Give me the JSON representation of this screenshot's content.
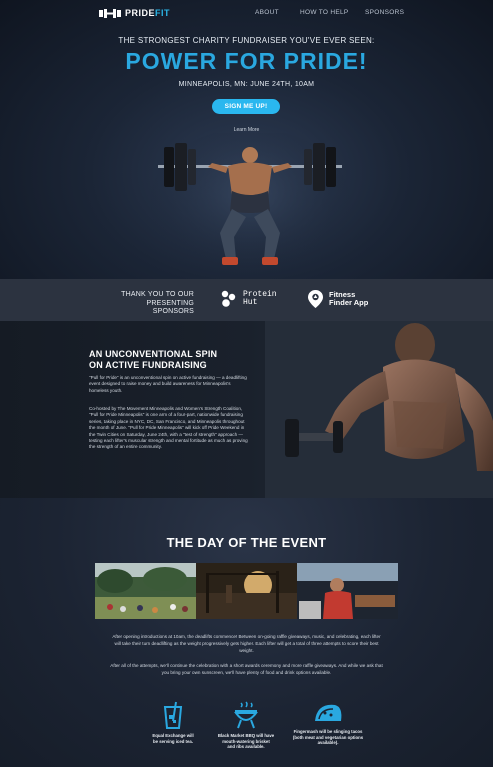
{
  "nav": {
    "brand_main": "PRIDE",
    "brand_accent": "FIT",
    "links": [
      "ABOUT",
      "HOW TO HELP",
      "SPONSORS"
    ]
  },
  "hero": {
    "tagline": "THE STRONGEST CHARITY FUNDRAISER YOU'VE EVER SEEN:",
    "headline": "POWER FOR PRIDE!",
    "when": "MINNEAPOLIS, MN: JUNE 24TH, 10AM",
    "cta": "SIGN ME UP!",
    "learn_more": "Learn More"
  },
  "sponsors": {
    "thanks_line1": "THANK YOU TO OUR",
    "thanks_line2": "PRESENTING SPONSORS",
    "sponsor1_line1": "Protein",
    "sponsor1_line2": "Hut",
    "sponsor2_line1": "Fitness",
    "sponsor2_line2": "Finder App"
  },
  "spin": {
    "title_line1": "AN UNCONVENTIONAL SPIN",
    "title_line2": "ON ACTIVE FUNDRAISING",
    "p1": "\"Pull for Pride\" is an unconventional spin on active fundraising — a deadlifting event designed to raise money and build awareness for Minneapolis's homeless youth.",
    "p2": "Co-hosted by The Movement Minneapolis and Women's Strength Coalition, \"Pull for Pride Minneapolis\" is one arm of a four-part, nationwide fundraising series, taking place in NYC, DC, San Francisco, and Minneapolis throughout the month of June. \"Pull for Pride Minneapolis\" will kick off Pride Weekend in the Twin Cities on Saturday, June 24th, with a \"test of strength\" approach — testing each lifter's muscular strength and mental fortitude as much as proving the strength of an entire community."
  },
  "day": {
    "title": "THE DAY OF THE EVENT",
    "p1": "After opening introductions at 10am, the deadlifts commence! Between on-going raffle giveaways, music, and celebrating, each lifter will take their turn deadlifting as the weight progressively gets higher. Each lifter will get a total of three attempts to score their best weight.",
    "p2": "After all of the attempts, we'll continue the celebration with a short awards ceremony and more raffle giveaways. And while we ask that you bring your own sunscreen, we'll have plenty of food and drink options available.",
    "features": [
      {
        "icon": "iced-tea-icon",
        "text_line1": "Equal Exchange will",
        "text_line2": "be serving iced tea.",
        "text_line3": ""
      },
      {
        "icon": "grill-icon",
        "text_line1": "Black Market BBQ will have",
        "text_line2": "mouth-watering brisket",
        "text_line3": "and ribs available."
      },
      {
        "icon": "taco-icon",
        "text_line1": "Fingermash will be slinging tacos",
        "text_line2": "(both meat and vegetarian options",
        "text_line3": "available)."
      }
    ]
  },
  "colors": {
    "accent": "#2aa8e0",
    "button": "#2ab7ef",
    "background": "#1a2230"
  }
}
